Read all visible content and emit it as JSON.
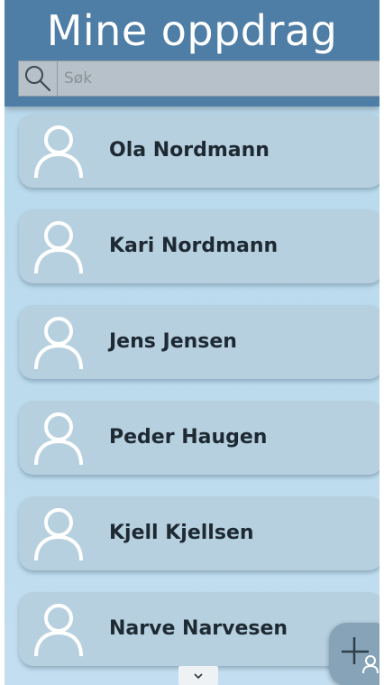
{
  "header": {
    "title": "Mine oppdrag"
  },
  "search": {
    "placeholder": "Søk",
    "value": "",
    "icon": "search-icon"
  },
  "contacts": [
    {
      "name": "Ola Nordmann",
      "icon": "person-icon"
    },
    {
      "name": "Kari Nordmann",
      "icon": "person-icon"
    },
    {
      "name": "Jens Jensen",
      "icon": "person-icon"
    },
    {
      "name": "Peder Haugen",
      "icon": "person-icon"
    },
    {
      "name": "Kjell Kjellsen",
      "icon": "person-icon"
    },
    {
      "name": "Narve Narvesen",
      "icon": "person-icon"
    }
  ],
  "fab": {
    "icon": "add-person-icon"
  },
  "scroll": {
    "icon": "chevron-down-icon"
  },
  "colors": {
    "header": "#4e7da6",
    "background": "#b9d9ec",
    "card": "#b7d0df",
    "text": "#1e2a33"
  }
}
